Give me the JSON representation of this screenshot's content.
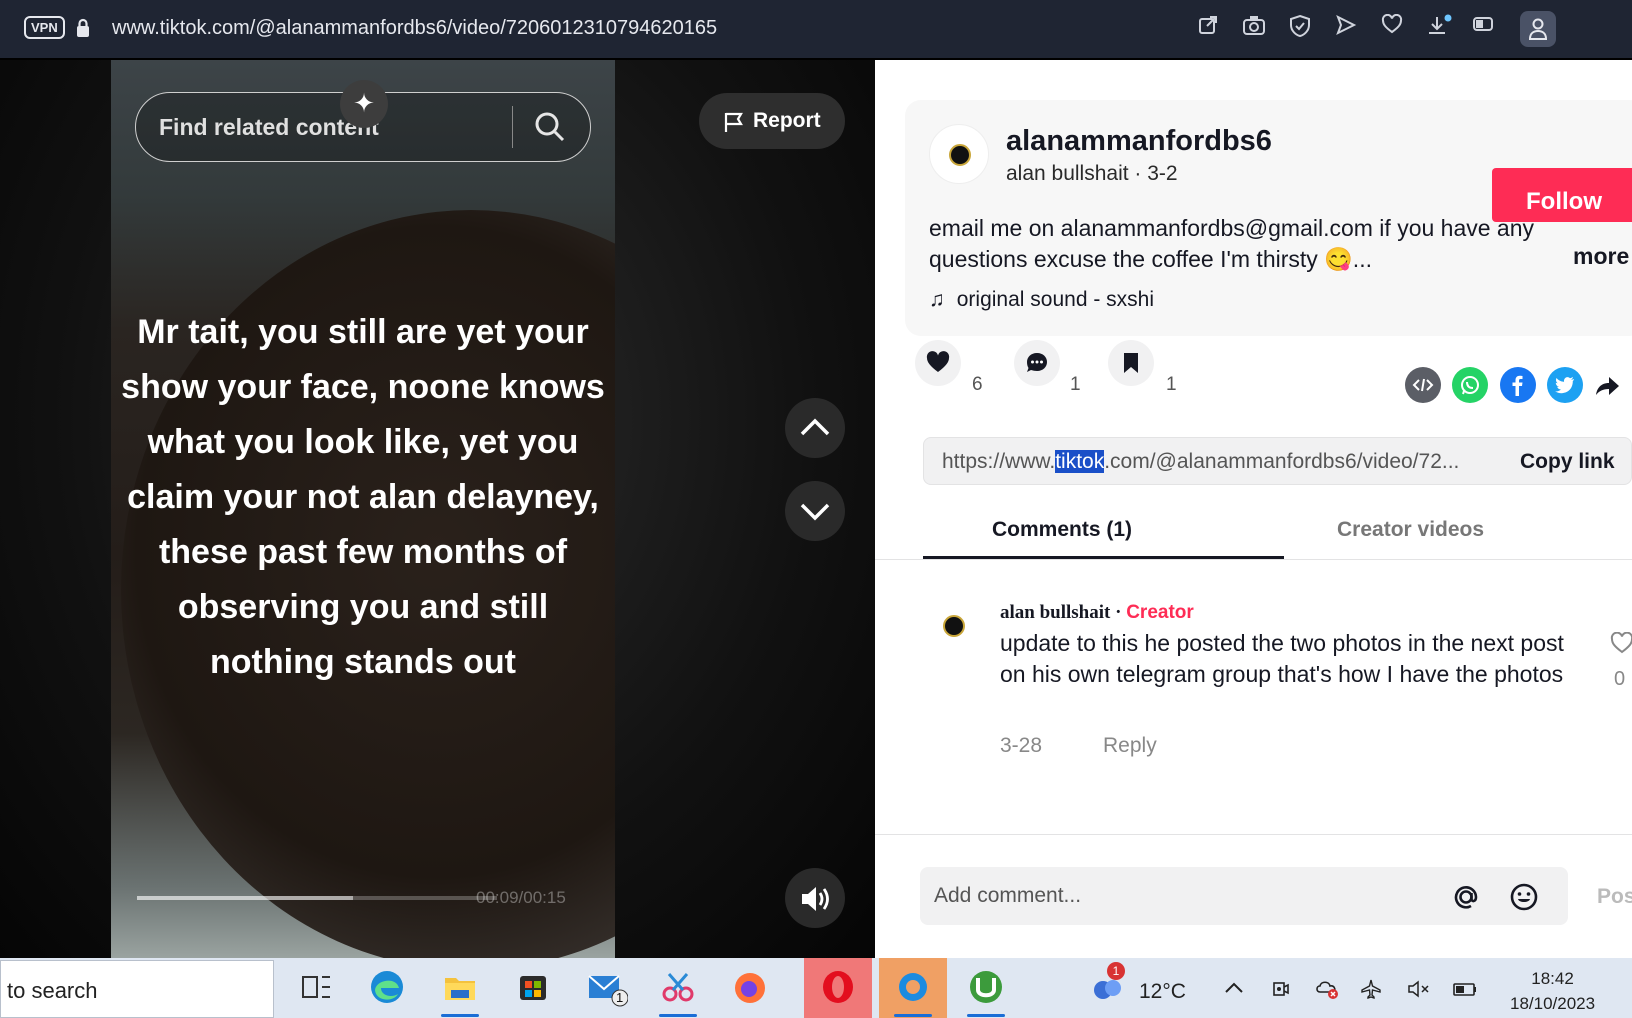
{
  "browser": {
    "vpn_label": "VPN",
    "url": "www.tiktok.com/@alanammanfordbs6/video/7206012310794620165",
    "icons": [
      "share-icon",
      "camera-icon",
      "shield-icon",
      "send-icon",
      "heart-icon",
      "download-icon",
      "battery-icon",
      "menu-icon",
      "profile-icon"
    ]
  },
  "video": {
    "search_placeholder": "Find related content",
    "report_label": "Report",
    "overlay_text": "Mr tait, you still are yet your show your face, noone knows what you look like, yet you claim your not alan delayney, these past few months of observing you and still nothing stands out",
    "time": "00:09/00:15",
    "progress": 0.6
  },
  "post": {
    "username": "alanammanfordbs6",
    "subline": "alan bullshait · 3-2",
    "follow_label": "Follow",
    "description": "email me on alanammanfordbs@gmail.com if you have any questions excuse the coffee I'm thirsty 😋...",
    "more_label": "more",
    "music": "original sound - sxshi",
    "likes": "6",
    "comments": "1",
    "saves": "1"
  },
  "link": {
    "prefix": "https://www.",
    "highlight": "tiktok",
    "suffix": ".com/@alanammanfordbs6/video/72...",
    "copy_label": "Copy link"
  },
  "tabs": {
    "comments": "Comments (1)",
    "creator_videos": "Creator videos"
  },
  "comment": {
    "author": "alan bullshait",
    "separator": " · ",
    "badge": "Creator",
    "text": "update to this he posted the two photos in the next post on his own telegram group that's how I have the photos",
    "date": "3-28",
    "reply_label": "Reply",
    "likes": "0"
  },
  "comment_box": {
    "placeholder": "Add comment...",
    "post_label": "Post"
  },
  "taskbar": {
    "search_text": "to search",
    "weather": "12°C",
    "weather_badge": "1",
    "mail_badge": "1",
    "time": "18:42",
    "date": "18/10/2023"
  }
}
